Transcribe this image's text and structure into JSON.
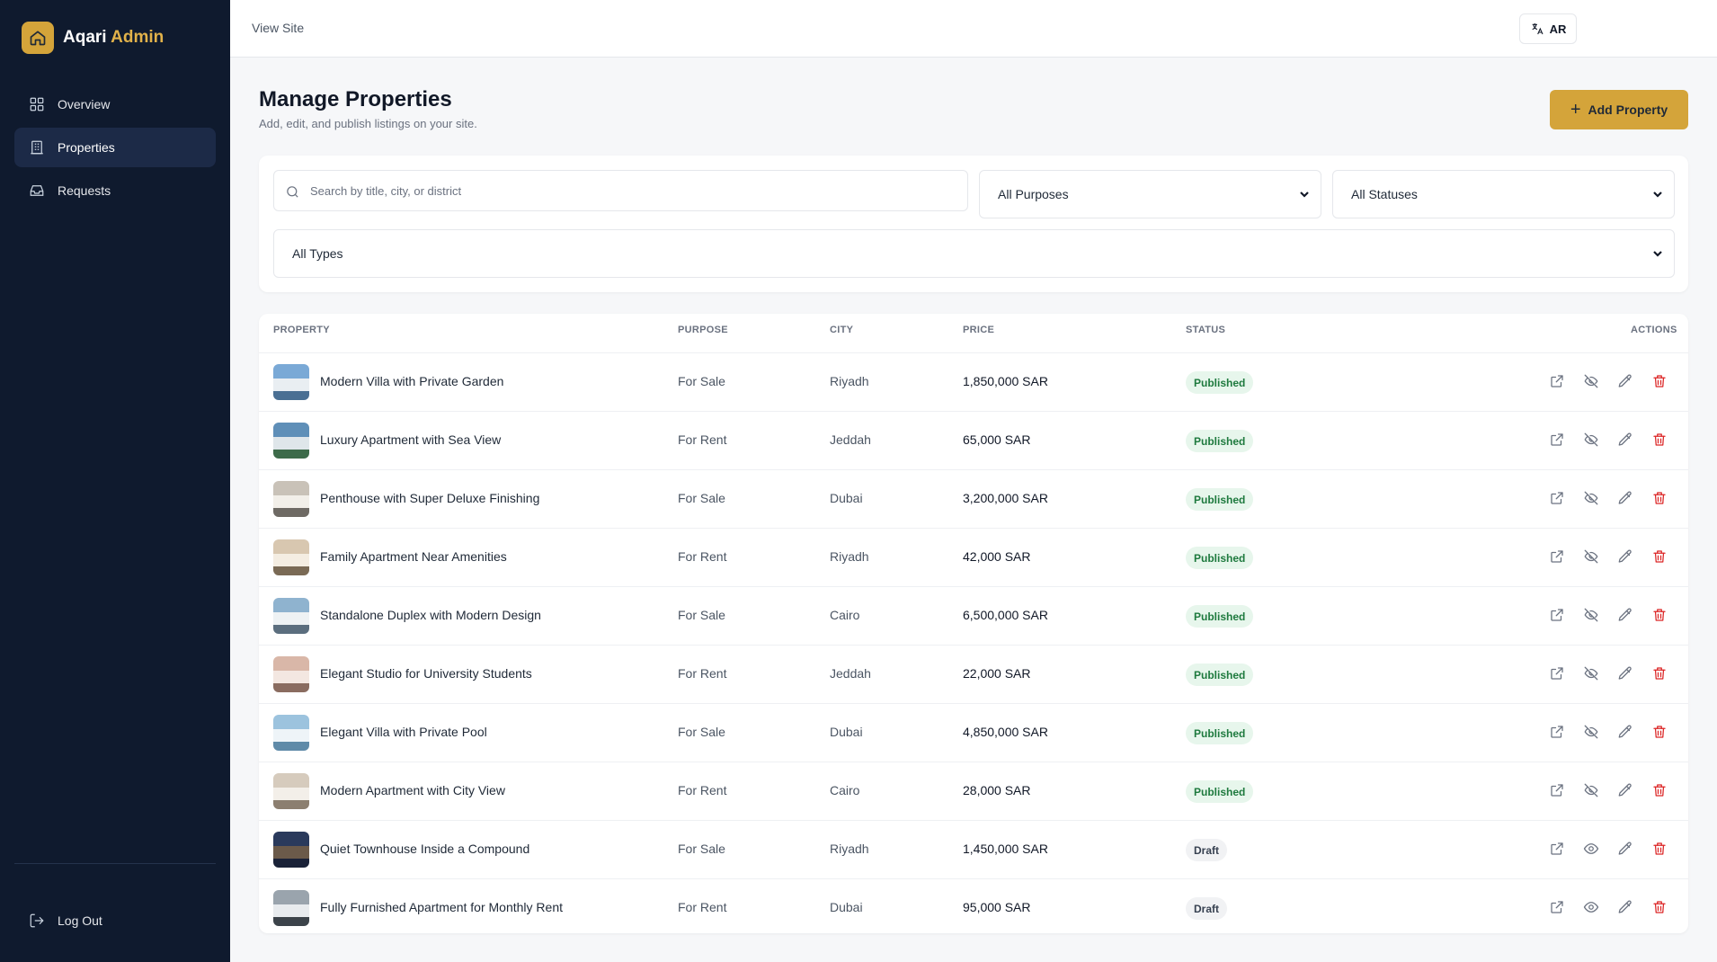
{
  "brand": {
    "name": "Aqari",
    "accent": "Admin"
  },
  "sidebar": {
    "items": [
      {
        "label": "Overview",
        "icon": "grid-icon"
      },
      {
        "label": "Properties",
        "icon": "building-icon"
      },
      {
        "label": "Requests",
        "icon": "inbox-icon"
      }
    ],
    "logout_label": "Log Out"
  },
  "topbar": {
    "view_site": "View Site",
    "lang_label": "AR"
  },
  "header": {
    "title": "Manage Properties",
    "subtitle": "Add, edit, and publish listings on your site.",
    "add_label": "Add Property"
  },
  "filters": {
    "search_placeholder": "Search by title, city, or district",
    "purpose": "All Purposes",
    "status": "All Statuses",
    "type": "All Types"
  },
  "table": {
    "headers": {
      "property": "Property",
      "purpose": "Purpose",
      "city": "City",
      "price": "Price",
      "status": "Status",
      "actions": "Actions"
    },
    "rows": [
      {
        "title": "Modern Villa with Private Garden",
        "purpose": "For Sale",
        "city": "Riyadh",
        "price": "1,850,000 SAR",
        "status": "Published"
      },
      {
        "title": "Luxury Apartment with Sea View",
        "purpose": "For Rent",
        "city": "Jeddah",
        "price": "65,000 SAR",
        "status": "Published"
      },
      {
        "title": "Penthouse with Super Deluxe Finishing",
        "purpose": "For Sale",
        "city": "Dubai",
        "price": "3,200,000 SAR",
        "status": "Published"
      },
      {
        "title": "Family Apartment Near Amenities",
        "purpose": "For Rent",
        "city": "Riyadh",
        "price": "42,000 SAR",
        "status": "Published"
      },
      {
        "title": "Standalone Duplex with Modern Design",
        "purpose": "For Sale",
        "city": "Cairo",
        "price": "6,500,000 SAR",
        "status": "Published"
      },
      {
        "title": "Elegant Studio for University Students",
        "purpose": "For Rent",
        "city": "Jeddah",
        "price": "22,000 SAR",
        "status": "Published"
      },
      {
        "title": "Elegant Villa with Private Pool",
        "purpose": "For Sale",
        "city": "Dubai",
        "price": "4,850,000 SAR",
        "status": "Published"
      },
      {
        "title": "Modern Apartment with City View",
        "purpose": "For Rent",
        "city": "Cairo",
        "price": "28,000 SAR",
        "status": "Published"
      },
      {
        "title": "Quiet Townhouse Inside a Compound",
        "purpose": "For Sale",
        "city": "Riyadh",
        "price": "1,450,000 SAR",
        "status": "Draft"
      },
      {
        "title": "Fully Furnished Apartment for Monthly Rent",
        "purpose": "For Rent",
        "city": "Dubai",
        "price": "95,000 SAR",
        "status": "Draft"
      }
    ]
  },
  "colors": {
    "sidebar_bg": "#0f1a2e",
    "accent": "#d4a43a",
    "published": "#1e7a3e",
    "danger": "#dc2626"
  }
}
